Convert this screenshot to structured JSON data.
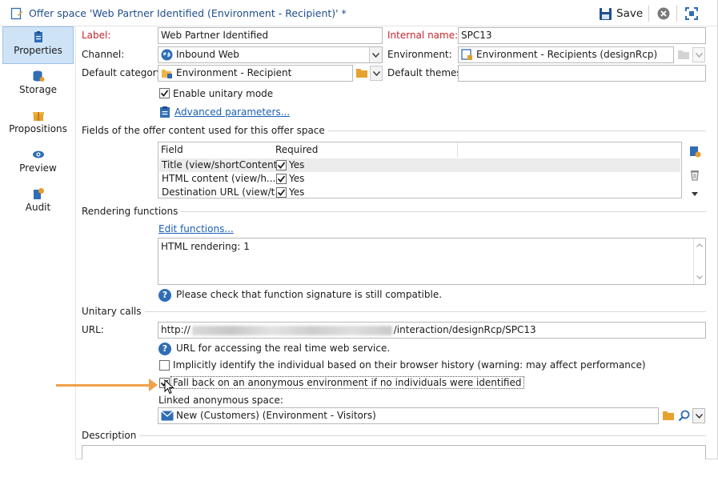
{
  "window": {
    "title": "Offer space 'Web Partner Identified (Environment - Recipient)' *",
    "save_label": "Save"
  },
  "sidebar": {
    "items": [
      {
        "label": "Properties",
        "icon": "clipboard-icon",
        "active": true
      },
      {
        "label": "Storage",
        "icon": "database-icon"
      },
      {
        "label": "Propositions",
        "icon": "gift-icon"
      },
      {
        "label": "Preview",
        "icon": "eye-icon"
      },
      {
        "label": "Audit",
        "icon": "audit-icon"
      }
    ]
  },
  "form": {
    "label_caption": "Label:",
    "label_value": "Web Partner Identified",
    "internal_name_caption": "Internal name:",
    "internal_name_value": "SPC13",
    "channel_caption": "Channel:",
    "channel_value": "Inbound Web",
    "environment_caption": "Environment:",
    "environment_value": "Environment - Recipients (designRcp)",
    "default_category_caption": "Default category:",
    "default_category_value": "Environment - Recipient",
    "default_themes_caption": "Default themes:",
    "default_themes_value": "",
    "enable_unitary_label": "Enable unitary mode",
    "advanced_params_label": "Advanced parameters..."
  },
  "fields_section": {
    "title": "Fields of the offer content used for this offer space",
    "columns": [
      "Field",
      "Required"
    ],
    "rows": [
      {
        "field": "Title (view/shortContent)",
        "required": "Yes"
      },
      {
        "field": "HTML content (view/h...",
        "required": "Yes"
      },
      {
        "field": "Destination URL (view/t...",
        "required": "Yes"
      }
    ]
  },
  "rendering_section": {
    "title": "Rendering functions",
    "edit_link": "Edit functions...",
    "content": "HTML rendering: 1",
    "help_text": "Please check that function signature is still compatible."
  },
  "unitary_section": {
    "title": "Unitary calls",
    "url_caption": "URL:",
    "url_prefix": "http://",
    "url_suffix": "/interaction/designRcp/SPC13",
    "url_help": "URL for accessing the real time web service.",
    "implicit_label": "Implicitly identify the individual based on their browser history (warning: may affect performance)",
    "fallback_label": "Fall back on an anonymous environment if no individuals were identified",
    "linked_caption": "Linked anonymous space:",
    "linked_value": "New (Customers) (Environment - Visitors)"
  },
  "description_section": {
    "title": "Description"
  },
  "colors": {
    "accent": "#1e4e8c",
    "required_label": "#c6262e",
    "active_tab": "#cfe3f6",
    "arrow": "#f0a04b"
  }
}
